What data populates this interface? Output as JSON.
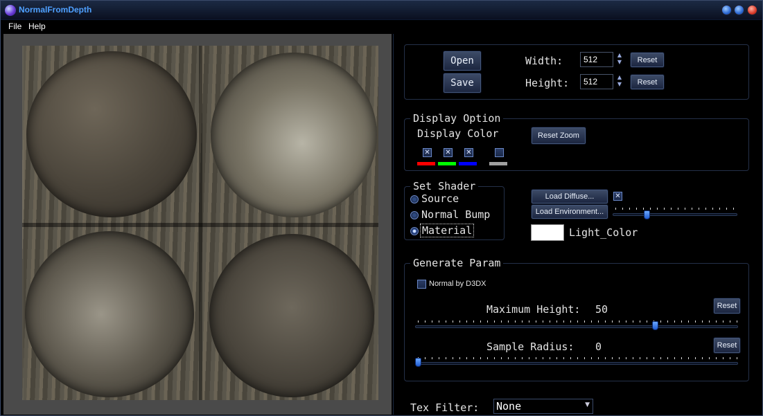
{
  "window": {
    "title": "NormalFromDepth"
  },
  "menu": {
    "items": [
      "File",
      "Help"
    ]
  },
  "file": {
    "open_label": "Open",
    "save_label": "Save",
    "width_label": "Width:",
    "width_value": "512",
    "height_label": "Height:",
    "height_value": "512",
    "reset_label": "Reset"
  },
  "display": {
    "legend": "Display Option",
    "color_label": "Display Color",
    "reset_zoom_label": "Reset Zoom",
    "channels": [
      {
        "name": "red",
        "checked": true,
        "color": "#ff0000"
      },
      {
        "name": "green",
        "checked": true,
        "color": "#00ff00"
      },
      {
        "name": "blue",
        "checked": true,
        "color": "#0000ff"
      },
      {
        "name": "alpha",
        "checked": false,
        "color": "#a0a0a0"
      }
    ],
    "check_glyph": "✕"
  },
  "shader": {
    "legend": "Set Shader",
    "options": [
      "Source",
      "Normal Bump",
      "Material"
    ],
    "selected": "Material",
    "load_diffuse_label": "Load Diffuse...",
    "load_environment_label": "Load Environment...",
    "diffuse_checked": true,
    "light_level": 0.26,
    "light_color_label": "Light_Color",
    "light_color": "#ffffff"
  },
  "generate": {
    "legend": "Generate Param",
    "normal_d3dx_label": "Normal by D3DX",
    "normal_d3dx_checked": false,
    "max_height_label": "Maximum Height:",
    "max_height_value": "50",
    "max_height_level": 0.75,
    "sample_radius_label": "Sample Radius:",
    "sample_radius_value": "0",
    "sample_radius_level": 0.0,
    "reset_label": "Reset"
  },
  "tex_filter": {
    "label": "Tex Filter:",
    "value": "None"
  }
}
